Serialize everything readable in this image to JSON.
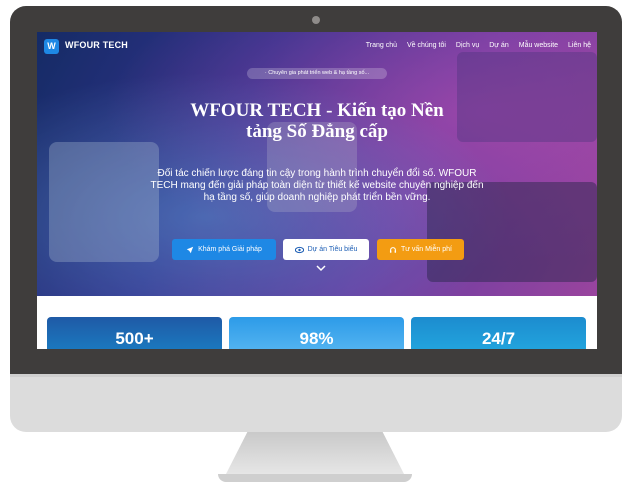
{
  "site": {
    "logo_letter": "W",
    "brand": "WFOUR TECH"
  },
  "nav": {
    "items": [
      "Trang chủ",
      "Về chúng tôi",
      "Dịch vụ",
      "Dự án",
      "Mẫu website",
      "Liên hệ"
    ]
  },
  "hero": {
    "tagline": "· Chuyên gia phát triển web & hạ tầng số...",
    "title_line1": "WFOUR TECH - Kiến tạo Nền",
    "title_line2": "tảng Số Đẳng cấp",
    "subtitle": "Đối tác chiến lược đáng tin cậy trong hành trình chuyển đổi số. WFOUR TECH mang đến giải pháp toàn diện từ thiết kế website chuyên nghiệp đến hạ tầng số, giúp doanh nghiệp phát triển bền vững.",
    "buttons": {
      "explore": "Khám phá Giải pháp",
      "projects": "Dự án Tiêu biểu",
      "consult": "Tư vấn Miễn phí"
    },
    "colors": {
      "primary": "#1e88e5",
      "accent": "#f39c12"
    }
  },
  "stats": [
    {
      "value": "500+"
    },
    {
      "value": "98%"
    },
    {
      "value": "24/7"
    }
  ],
  "icons": {
    "explore": "rocket-icon",
    "projects": "eye-icon",
    "consult": "headset-icon",
    "scroll": "chevron-down-icon"
  }
}
